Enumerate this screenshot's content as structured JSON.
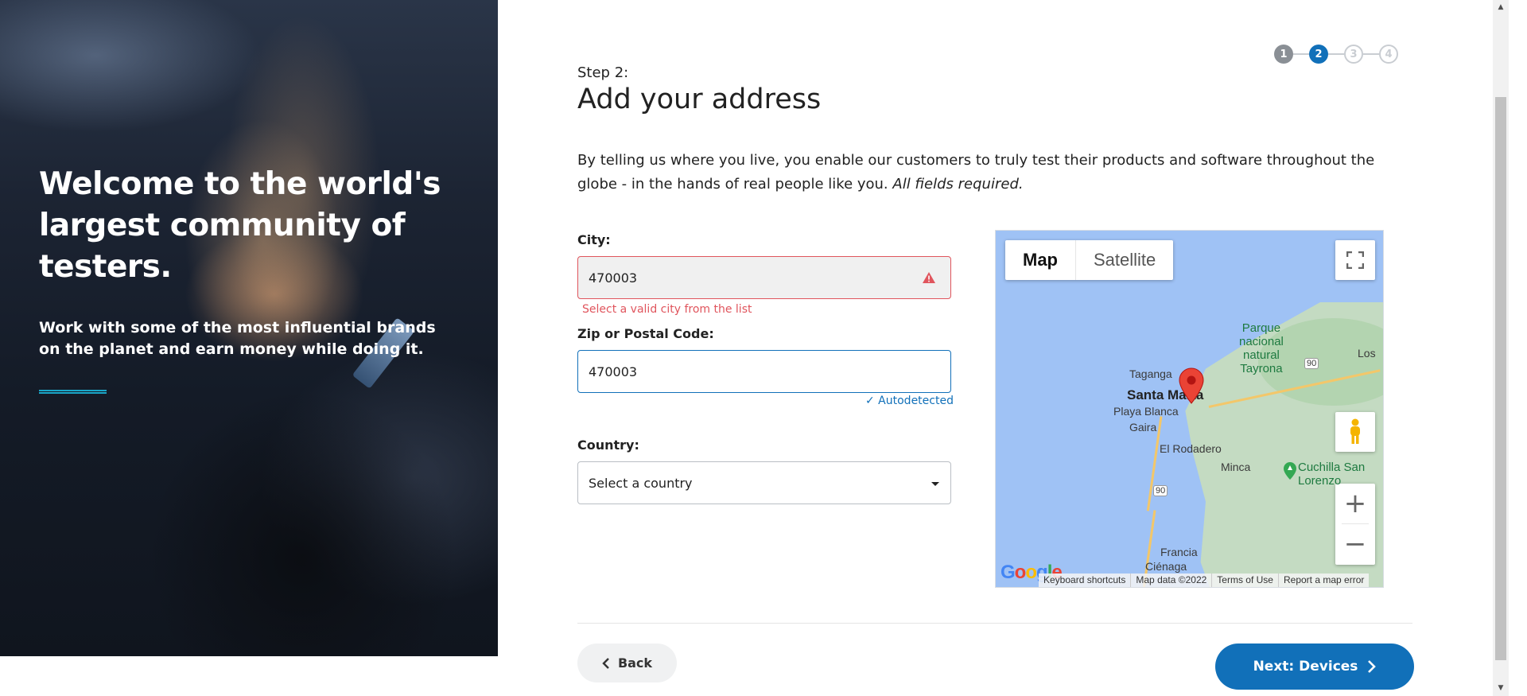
{
  "hero": {
    "title": "Welcome to the world's largest community of testers.",
    "subtitle": "Work with some of the most influential brands on the planet and earn money while doing it."
  },
  "stepper": {
    "steps": [
      "1",
      "2",
      "3",
      "4"
    ],
    "current": 2
  },
  "header": {
    "step_label": "Step 2:",
    "title": "Add your address",
    "intro": "By telling us where you live, you enable our customers to truly test their products and software throughout the globe - in the hands of real people like you.",
    "intro_emphasis": "All fields required."
  },
  "form": {
    "city": {
      "label": "City:",
      "value": "470003",
      "error": "Select a valid city from the list"
    },
    "zip": {
      "label": "Zip or Postal Code:",
      "value": "470003",
      "hint": "✓ Autodetected"
    },
    "country": {
      "label": "Country:",
      "value": "Select a country"
    }
  },
  "map": {
    "type_map": "Map",
    "type_satellite": "Satellite",
    "zoom_in": "+",
    "zoom_out": "−",
    "labels": {
      "park": "Parque\nnacional\nnatural\nTayrona",
      "los": "Los",
      "route90_top": "90",
      "taganga": "Taganga",
      "santa_marta": "Santa Marta",
      "playa_blanca": "Playa Blanca",
      "gaira": "Gaira",
      "el_rodadero": "El Rodadero",
      "minca": "Minca",
      "cuchilla": "Cuchilla San\nLorenzo",
      "route90_bottom": "90",
      "francia": "Francia",
      "cienaga": "Ciénaga"
    },
    "footer": {
      "shortcuts": "Keyboard shortcuts",
      "data": "Map data ©2022",
      "terms": "Terms of Use",
      "report": "Report a map error"
    },
    "logo": "Google"
  },
  "actions": {
    "back": "Back",
    "next": "Next: Devices"
  },
  "colors": {
    "primary": "#1170b9",
    "error": "#e0555d",
    "accent_rule": "#1aa7c9"
  }
}
